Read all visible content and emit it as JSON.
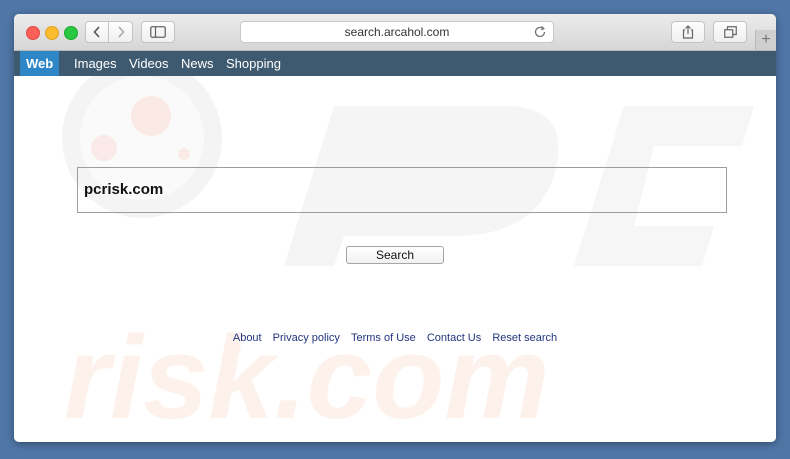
{
  "browser": {
    "address": "search.arcahol.com",
    "new_tab_label": "+"
  },
  "navbar": {
    "items": [
      "Web",
      "Images",
      "Videos",
      "News",
      "Shopping"
    ],
    "active": "Web"
  },
  "search": {
    "value": "pcrisk.com",
    "button_label": "Search"
  },
  "footer": {
    "links": [
      "About",
      "Privacy policy",
      "Terms of Use",
      "Contact Us",
      "Reset search"
    ]
  },
  "watermark": {
    "text": "risk.com"
  },
  "colors": {
    "background": "#4f76a6",
    "navbar": "#3e5a70",
    "navbar_active": "#2f86c6",
    "link": "#23357f"
  }
}
